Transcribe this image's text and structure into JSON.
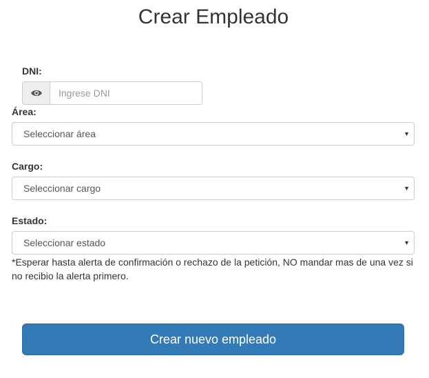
{
  "page": {
    "title": "Crear Empleado"
  },
  "dni": {
    "label": "DNI:",
    "placeholder": "Ingrese DNI",
    "value": "",
    "icon": "eye-icon"
  },
  "area": {
    "label": "Área:",
    "selected": "Seleccionar área"
  },
  "cargo": {
    "label": "Cargo:",
    "selected": "Seleccionar cargo"
  },
  "estado": {
    "label": "Estado:",
    "selected": "Seleccionar estado"
  },
  "note": "*Esperar hasta alerta de confirmación o rechazo de la petición, NO mandar mas de una vez si no recibio la alerta primero.",
  "submit": {
    "label": "Crear nuevo empleado"
  },
  "colors": {
    "primary": "#337ab7",
    "border": "#cccccc",
    "addon_bg": "#eeeeee"
  }
}
